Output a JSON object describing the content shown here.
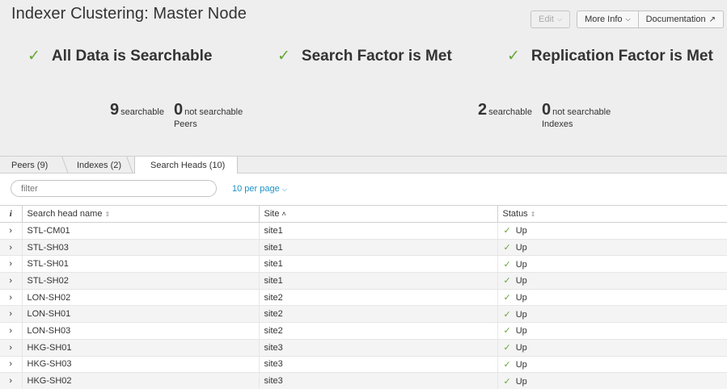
{
  "header": {
    "title": "Indexer Clustering: Master Node",
    "buttons": {
      "edit": "Edit",
      "more_info": "More Info",
      "documentation": "Documentation"
    }
  },
  "factors": [
    {
      "icon": "check-icon",
      "label": "All Data is Searchable"
    },
    {
      "icon": "check-icon",
      "label": "Search Factor is Met"
    },
    {
      "icon": "check-icon",
      "label": "Replication Factor is Met"
    }
  ],
  "peers_stats": {
    "searchable_count": "9",
    "searchable_label": "searchable",
    "not_searchable_count": "0",
    "not_searchable_label": "not searchable",
    "caption": "Peers"
  },
  "indexes_stats": {
    "searchable_count": "2",
    "searchable_label": "searchable",
    "not_searchable_count": "0",
    "not_searchable_label": "not searchable",
    "caption": "Indexes"
  },
  "tabs": [
    {
      "label": "Peers (9)"
    },
    {
      "label": "Indexes (2)"
    },
    {
      "label": "Search Heads (10)"
    }
  ],
  "filter": {
    "placeholder": "filter",
    "per_page": "10 per page"
  },
  "table": {
    "columns": {
      "info": "i",
      "name": "Search head name",
      "site": "Site",
      "status": "Status"
    },
    "rows": [
      {
        "name": "STL-CM01",
        "site": "site1",
        "status": "Up"
      },
      {
        "name": "STL-SH03",
        "site": "site1",
        "status": "Up"
      },
      {
        "name": "STL-SH01",
        "site": "site1",
        "status": "Up"
      },
      {
        "name": "STL-SH02",
        "site": "site1",
        "status": "Up"
      },
      {
        "name": "LON-SH02",
        "site": "site2",
        "status": "Up"
      },
      {
        "name": "LON-SH01",
        "site": "site2",
        "status": "Up"
      },
      {
        "name": "LON-SH03",
        "site": "site2",
        "status": "Up"
      },
      {
        "name": "HKG-SH01",
        "site": "site3",
        "status": "Up"
      },
      {
        "name": "HKG-SH03",
        "site": "site3",
        "status": "Up"
      },
      {
        "name": "HKG-SH02",
        "site": "site3",
        "status": "Up"
      }
    ]
  },
  "colors": {
    "accent_green": "#65a637",
    "link_blue": "#1e93c6",
    "header_bg": "#eeeeee"
  }
}
